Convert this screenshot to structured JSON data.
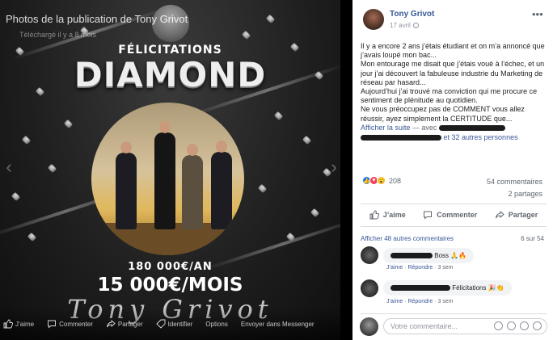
{
  "viewer": {
    "caption": "Photos de la publication de Tony Grivot",
    "download_hint": "Téléchargé il y a 8 mois",
    "headline": "FÉLICITATIONS",
    "rank": "DIAMOND",
    "salary_year": "180 000€/AN",
    "salary_month": "15 000€/MOIS",
    "signature": "Tony Grivot",
    "bottom_actions": [
      "J’aime",
      "Commenter",
      "Partager",
      "Identifier",
      "Options",
      "Envoyer dans Messenger"
    ]
  },
  "post": {
    "author": "Tony Grivot",
    "date": "17 avril",
    "paragraphs": [
      "Il y a encore 2 ans j’étais étudiant et on m’a annoncé que j’avais loupé mon bac...",
      "Mon entourage me disait que j’étais voué à l’échec, et un jour j’ai découvert la fabuleuse industrie du Marketing de réseau par hasard...",
      "Aujourd’hui j’ai trouvé ma conviction qui me procure ce sentiment de plénitude au quotidien.",
      "Ne vous préoccupez pas de COMMENT vous allez réussir, ayez simplement la CERTITUDE que..."
    ],
    "see_more": "Afficher la suite",
    "with": "— avec",
    "and_others": "et 32 autres personnes",
    "reaction_count": "208",
    "comments_count": "54 commentaires",
    "shares_count": "2 partages",
    "actions": {
      "like": "J’aime",
      "comment": "Commenter",
      "share": "Partager"
    },
    "previous_comments": "Afficher 48 autres commentaires",
    "pager": "6 sur 54",
    "comments": [
      {
        "text": "Boss 🙏🔥",
        "like": "J’aime",
        "reply": "Répondre",
        "time": "3 sem"
      },
      {
        "text": "Félicitations 🎉👏",
        "like": "J’aime",
        "reply": "Répondre",
        "time": "3 sem"
      }
    ],
    "write_placeholder": "Votre commentaire..."
  },
  "colors": {
    "link": "#385898",
    "like_blue": "#1877f2",
    "love_red": "#f33e58",
    "wow_yellow": "#f7b125"
  }
}
